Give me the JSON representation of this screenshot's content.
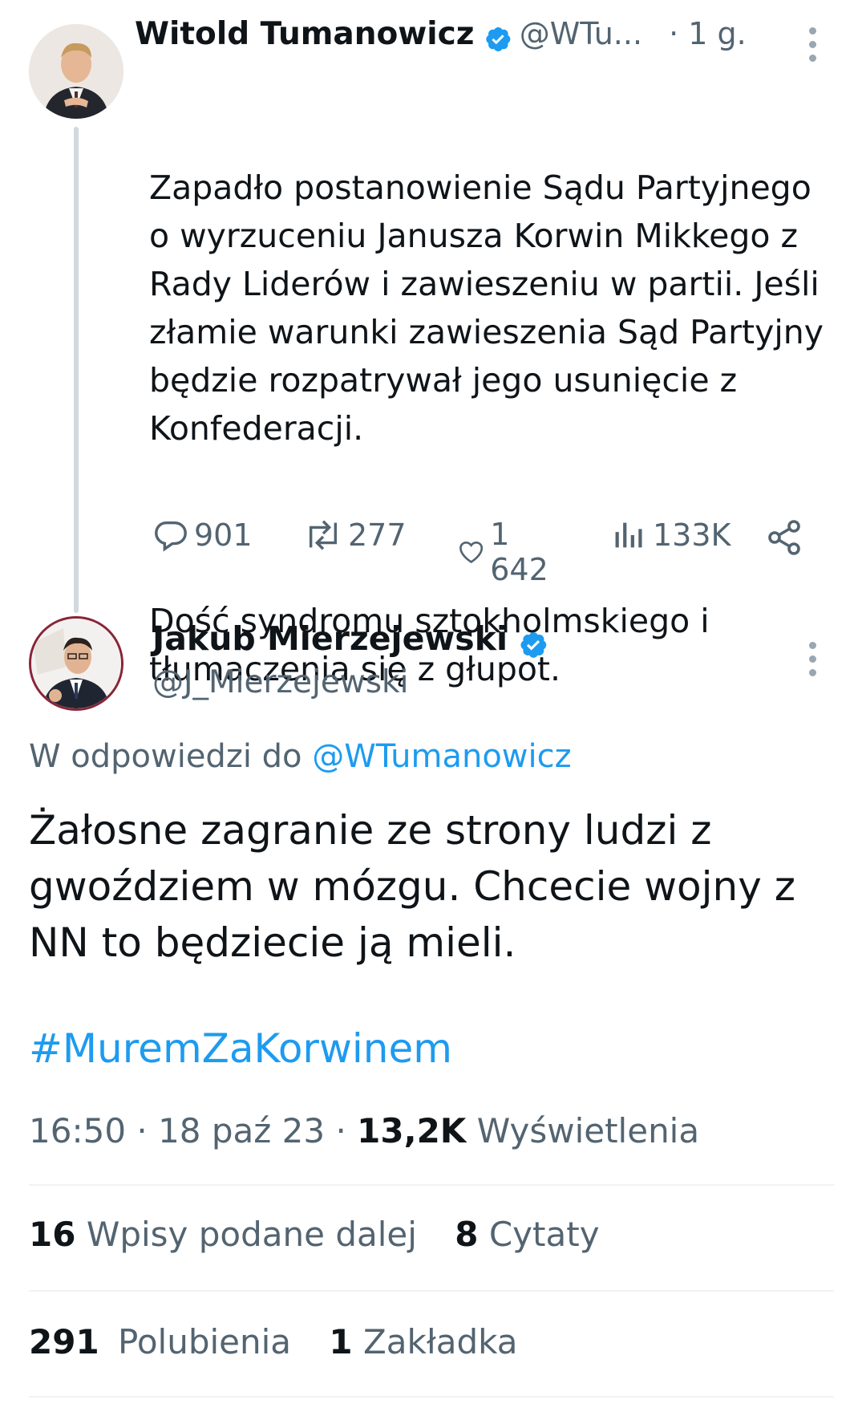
{
  "tweet1": {
    "author_name": "Witold Tumanowicz",
    "handle": "@WTu...",
    "time": "· 1 g.",
    "text": "Zapadło postanowienie Sądu Partyjnego o wyrzuceniu Janusza Korwin Mikkego z Rady Liderów i zawieszeniu w partii. Jeśli złamie warunki zawieszenia Sąd Partyjny będzie rozpatrywał jego usunięcie z Konfederacji.",
    "text2": "Dość syndromu sztokholmskiego i tłumaczenia się z głupot.",
    "replies": "901",
    "retweets": "277",
    "likes": "1 642",
    "views": "133K"
  },
  "tweet2": {
    "author_name": "Jakub Mierzejewski",
    "handle": "@J_Mierzejewski",
    "reply_prefix": "W odpowiedzi do ",
    "reply_handle": "@WTumanowicz",
    "text": "Żałosne zagranie ze strony ludzi z gwoździem w mózgu. Chcecie wojny z NN to będziecie ją mieli.",
    "hashtag": "#MuremZaKorwinem",
    "time": "16:50 · 18 paź 23 · ",
    "views_count": "13,2K",
    "views_label": "Wyświetlenia",
    "retweets_count": "16",
    "retweets_label": "Wpisy podane dalej",
    "quotes_count": "8",
    "quotes_label": "Cytaty",
    "likes_count": "291",
    "likes_label": "Polubienia",
    "bookmarks_count": "1",
    "bookmarks_label": "Zakładka"
  },
  "colors": {
    "accent": "#1d9bf0",
    "muted": "#536471",
    "text": "#0f1419"
  }
}
